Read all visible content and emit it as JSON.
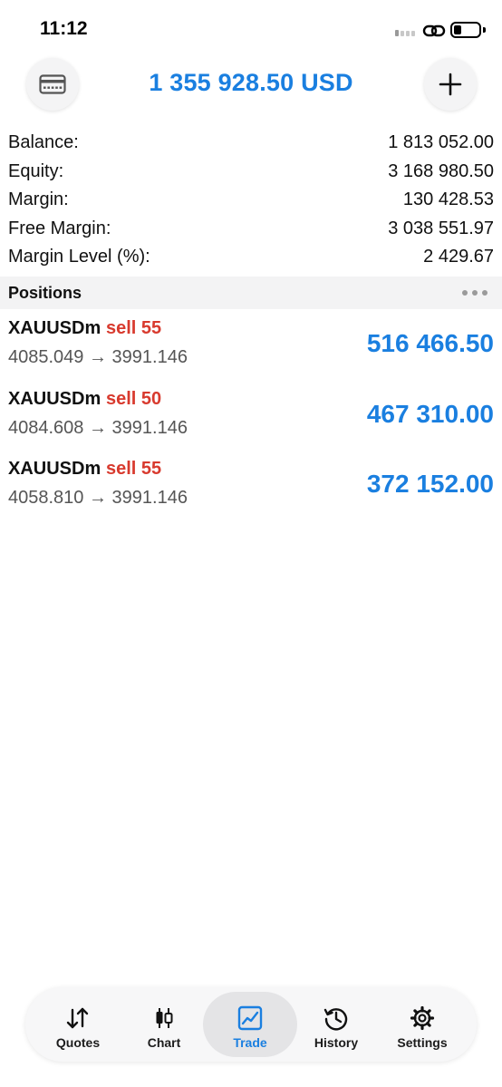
{
  "status": {
    "time": "11:12"
  },
  "header": {
    "account_title": "1 355 928.50 USD"
  },
  "summary": [
    {
      "label": "Balance:",
      "value": "1 813 052.00"
    },
    {
      "label": "Equity:",
      "value": "3 168 980.50"
    },
    {
      "label": "Margin:",
      "value": "130 428.53"
    },
    {
      "label": "Free Margin:",
      "value": "3 038 551.97"
    },
    {
      "label": "Margin Level (%):",
      "value": "2 429.67"
    }
  ],
  "positions": {
    "title": "Positions",
    "items": [
      {
        "symbol": "XAUUSDm",
        "side": "sell 55",
        "prices": "4085.049 → 3991.146",
        "profit": "516 466.50"
      },
      {
        "symbol": "XAUUSDm",
        "side": "sell 50",
        "prices": "4084.608 → 3991.146",
        "profit": "467 310.00"
      },
      {
        "symbol": "XAUUSDm",
        "side": "sell 55",
        "prices": "4058.810 → 3991.146",
        "profit": "372 152.00"
      }
    ]
  },
  "tabbar": {
    "tabs": [
      {
        "label": "Quotes",
        "icon": "quotes-arrows-icon",
        "active": false
      },
      {
        "label": "Chart",
        "icon": "candlestick-icon",
        "active": false
      },
      {
        "label": "Trade",
        "icon": "trade-chart-icon",
        "active": true
      },
      {
        "label": "History",
        "icon": "history-clock-icon",
        "active": false
      },
      {
        "label": "Settings",
        "icon": "gear-icon",
        "active": false
      }
    ]
  },
  "colors": {
    "accent": "#1a7fe0",
    "sell": "#d83a2e"
  }
}
